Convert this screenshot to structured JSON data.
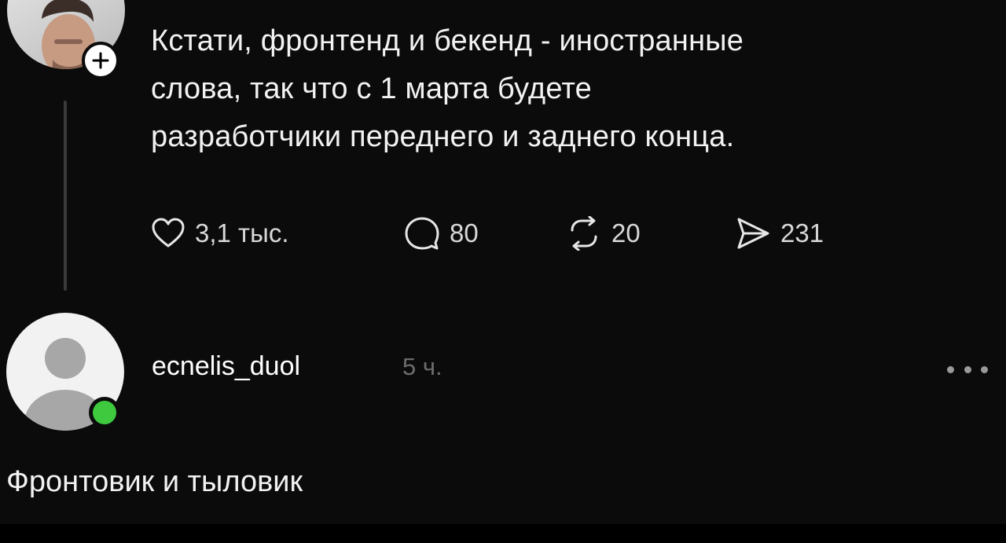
{
  "post": {
    "text_lines": [
      "Кстати, фронтенд и бекенд - иностранные",
      "слова, так что с 1 марта будете",
      "разработчики переднего и заднего конца."
    ],
    "actions": {
      "likes": "3,1 тыс.",
      "comments": "80",
      "reposts": "20",
      "shares": "231"
    }
  },
  "reply": {
    "username": "ecnelis_duol",
    "time": "5 ч.",
    "text": "Фронтовик и тыловик",
    "online": true
  },
  "icons": {
    "follow": "plus-icon",
    "like": "heart-icon",
    "comment": "comment-icon",
    "repost": "repost-icon",
    "share": "send-icon",
    "more": "more-dots-icon"
  },
  "colors": {
    "background": "#0b0b0b",
    "online": "#3ec93e",
    "muted_text": "#6d6d6d"
  }
}
